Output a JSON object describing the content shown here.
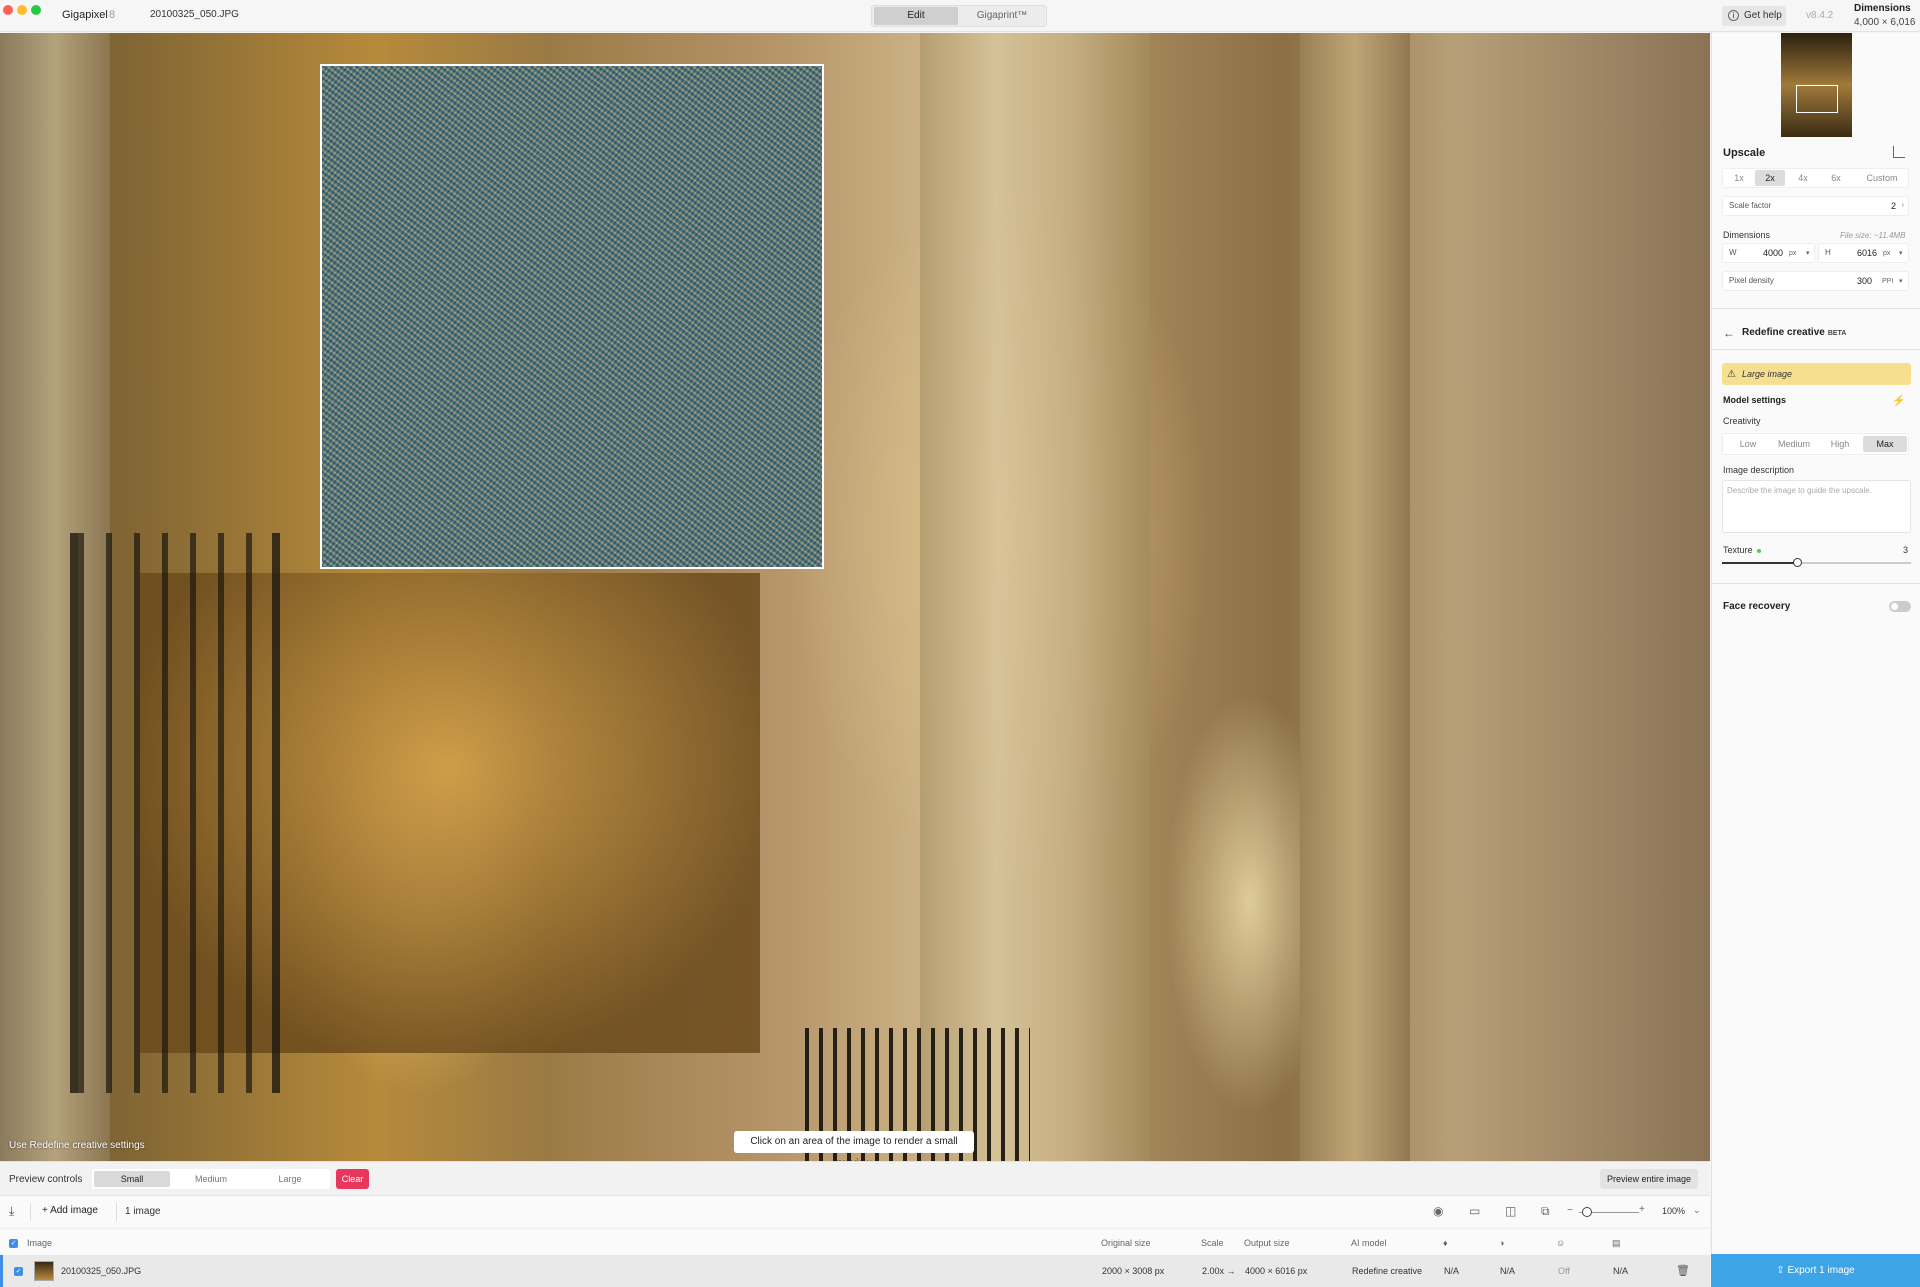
{
  "titlebar": {
    "app_name": "Gigapixel",
    "app_version": "8",
    "file_name": "20100325_050.JPG",
    "modes": [
      "Edit",
      "Gigaprint™"
    ],
    "active_mode": "Edit",
    "help_label": "Get help",
    "version": "v8.4.2",
    "dimensions_label": "Dimensions",
    "dimensions_value": "4,000 × 6,016"
  },
  "canvas": {
    "settings_note": "Use Redefine creative settings",
    "tooltip": "Click on an area of the image to render a small preview"
  },
  "panel": {
    "upscale_title": "Upscale",
    "scale_options": [
      "1x",
      "2x",
      "4x",
      "6x",
      "Custom"
    ],
    "active_scale": "2x",
    "scale_factor_label": "Scale factor",
    "scale_factor_value": "2",
    "dimensions_title": "Dimensions",
    "file_size": "File size: ~11.4MB",
    "width_label": "W",
    "width_value": "4000",
    "height_label": "H",
    "height_value": "6016",
    "unit_px": "px",
    "pixel_density_label": "Pixel density",
    "pixel_density_value": "300",
    "pixel_density_unit": "PPI",
    "model_title": "Redefine creative",
    "model_badge": "BETA",
    "warning": "Large image",
    "model_settings_title": "Model settings",
    "creativity_label": "Creativity",
    "creativity_options": [
      "Low",
      "Medium",
      "High",
      "Max"
    ],
    "active_creativity": "Max",
    "image_description_label": "Image description",
    "image_description_placeholder": "Describe the image to guide the upscale.",
    "texture_label": "Texture",
    "texture_value": "3",
    "texture_level_fraction": 0.4,
    "face_recovery_label": "Face recovery",
    "face_recovery_on": false,
    "export_label": "Export 1 image"
  },
  "preview_controls": {
    "label": "Preview controls",
    "sizes": [
      "Small",
      "Medium",
      "Large"
    ],
    "active_size": "Small",
    "clear_label": "Clear",
    "preview_entire_label": "Preview entire image"
  },
  "toolbar": {
    "add_image_label": "Add image",
    "image_count": "1 image",
    "zoom": "100%"
  },
  "table": {
    "headers": {
      "image": "Image",
      "original_size": "Original size",
      "scale": "Scale",
      "output_size": "Output size",
      "ai_model": "AI model"
    },
    "rows": [
      {
        "name": "20100325_050.JPG",
        "original_size": "2000 × 3008 px",
        "scale": "2.00x →",
        "output_size": "4000 × 6016 px",
        "ai_model": "Redefine creative",
        "col1": "N/A",
        "col2": "N/A",
        "col3": "Off",
        "col4": "N/A"
      }
    ]
  },
  "colors": {
    "accent": "#3ea4e8",
    "clear": "#e8365d",
    "warning": "#f6df8f"
  }
}
